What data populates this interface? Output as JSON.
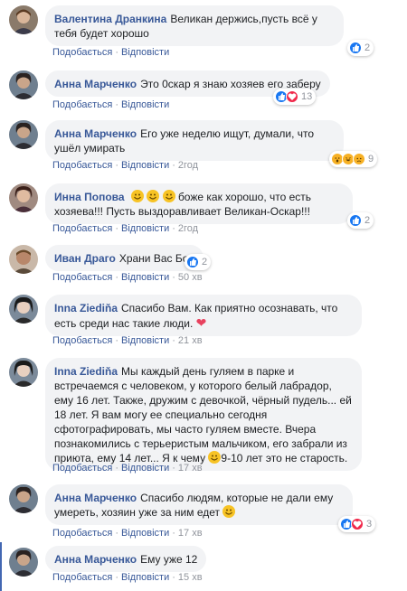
{
  "actions": {
    "like": "Подобається",
    "reply": "Відповісти",
    "dot": "·"
  },
  "comments": [
    {
      "author": "Валентина Дранкина",
      "text": "Великан держись,пусть всё у тебя будет хорошо",
      "time": "",
      "reaction_count": "2",
      "reactions": [
        "like"
      ]
    },
    {
      "author": "Анна Марченко",
      "text": "Это 0скар я знаю хозяев его заберу",
      "time": "",
      "reaction_count": "13",
      "reactions": [
        "like",
        "love"
      ]
    },
    {
      "author": "Анна Марченко",
      "text": "Его уже неделю ищут, думали, что ушёл умирать",
      "time": "2год",
      "reaction_count": "9",
      "reactions": [
        "wow",
        "haha",
        "sad"
      ]
    },
    {
      "author": "Инна Попова",
      "text_before": "",
      "text": "боже как хорошо, что есть хозяева!!! Пусть выздоравливает Великан-Оскар!!!",
      "time": "2год",
      "reaction_count": "2",
      "reactions": [
        "like"
      ]
    },
    {
      "author": "Иван Драго",
      "text": "Храни Вас Бог.",
      "time": "50 хв",
      "reaction_count": "2",
      "reactions": [
        "like"
      ]
    },
    {
      "author": "Inna Ziediňa",
      "text": "Спасибо Вам. Как приятно осознавать, что есть среди нас такие люди.",
      "time": "21 хв",
      "reaction_count": "",
      "reactions": []
    },
    {
      "author": "Inna Ziediňa",
      "text": "Мы каждый день гуляем в парке и встречаемся с человеком, у которого белый лабрадор, ему 16 лет. Также, дружим с девочкой, чёрный пудель... ей 18 лет. Я вам могу ее специально сегодня сфотографировать, мы часто гуляем вместе. Вчера познакомились с терьеристым мальчиком, его забрали из приюта, ему 14 лет... Я к чему",
      "text_after": "9-10 лет это не старость.",
      "time": "17 хв",
      "reaction_count": "",
      "reactions": []
    },
    {
      "author": "Анна Марченко",
      "text": "Спасибо людям, которые не дали ему умереть, хозяин уже за ним едет",
      "time": "17 хв",
      "reaction_count": "3",
      "reactions": [
        "like",
        "love"
      ]
    },
    {
      "author": "Анна Марченко",
      "text": "Ему уже 12",
      "time": "15 хв",
      "reaction_count": "",
      "reactions": []
    }
  ],
  "colors": {
    "link": "#385898",
    "bubble": "#f2f3f5",
    "like": "#1877f2",
    "love": "#f0284a",
    "emoji": "#f7b125"
  }
}
